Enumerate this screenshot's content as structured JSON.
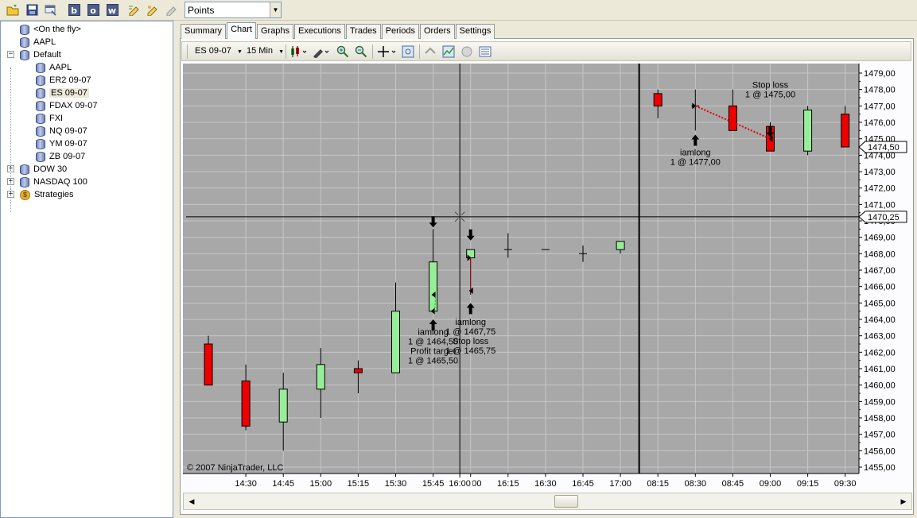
{
  "toolbar": {
    "buttons": [
      {
        "icon": "open-folder-icon"
      },
      {
        "icon": "save-icon"
      },
      {
        "icon": "window-icon"
      },
      {
        "label": "b"
      },
      {
        "label": "o"
      },
      {
        "label": "w"
      },
      {
        "icon": "pencil-icon"
      },
      {
        "icon": "edit-icon"
      },
      {
        "icon": "delete-icon"
      }
    ],
    "combo_value": "Points"
  },
  "tree": {
    "items": [
      {
        "label": "<On the fly>",
        "level": 1
      },
      {
        "label": "AAPL",
        "level": 1
      },
      {
        "label": "Default",
        "level": 0,
        "toggle": "−"
      },
      {
        "label": "AAPL",
        "level": 2
      },
      {
        "label": "ER2 09-07",
        "level": 2
      },
      {
        "label": "ES 09-07",
        "level": 2,
        "selected": true
      },
      {
        "label": "FDAX 09-07",
        "level": 2
      },
      {
        "label": "FXI",
        "level": 2
      },
      {
        "label": "NQ 09-07",
        "level": 2
      },
      {
        "label": "YM 09-07",
        "level": 2
      },
      {
        "label": "ZB 09-07",
        "level": 2
      },
      {
        "label": "DOW 30",
        "level": 0,
        "toggle": "+"
      },
      {
        "label": "NASDAQ 100",
        "level": 0,
        "toggle": "+"
      },
      {
        "label": "Strategies",
        "level": 0,
        "toggle": "+",
        "icon": "money"
      }
    ]
  },
  "tabs": [
    {
      "label": "Summary"
    },
    {
      "label": "Chart",
      "active": true
    },
    {
      "label": "Graphs"
    },
    {
      "label": "Executions"
    },
    {
      "label": "Trades"
    },
    {
      "label": "Periods"
    },
    {
      "label": "Orders"
    },
    {
      "label": "Settings"
    }
  ],
  "chart_toolbar": {
    "instrument": "ES 09-07",
    "interval": "15 Min"
  },
  "chart_data": {
    "type": "candlestick",
    "copyright": "© 2007 NinjaTrader, LLC",
    "ylim": [
      1454.5,
      1479.75
    ],
    "y_ticks": [
      "1455,00",
      "1456,00",
      "1457,00",
      "1458,00",
      "1459,00",
      "1460,00",
      "1461,00",
      "1462,00",
      "1463,00",
      "1464,00",
      "1465,00",
      "1466,00",
      "1467,00",
      "1468,00",
      "1469,00",
      "1470,00",
      "1471,00",
      "1472,00",
      "1473,00",
      "1474,00",
      "1475,00",
      "1476,00",
      "1477,00",
      "1478,00",
      "1479,00"
    ],
    "x_labels": [
      "14:30",
      "14:45",
      "15:00",
      "15:15",
      "15:30",
      "15:45",
      "16:00",
      "16:15",
      "16:30",
      "16:45",
      "17:00",
      "08:15",
      "08:30",
      "08:45",
      "09:00",
      "09:15",
      "09:30"
    ],
    "bars": [
      {
        "time": "14:15",
        "open": 1462.5,
        "high": 1463.0,
        "low": 1460.0,
        "close": 1460.0
      },
      {
        "time": "14:30",
        "open": 1460.25,
        "high": 1461.25,
        "low": 1457.25,
        "close": 1457.5
      },
      {
        "time": "14:45",
        "open": 1457.75,
        "high": 1460.75,
        "low": 1456.0,
        "close": 1459.75
      },
      {
        "time": "15:00",
        "open": 1459.75,
        "high": 1462.25,
        "low": 1458.0,
        "close": 1461.25
      },
      {
        "time": "15:15",
        "open": 1461.0,
        "high": 1461.5,
        "low": 1459.5,
        "close": 1460.75
      },
      {
        "time": "15:30",
        "open": 1460.75,
        "high": 1466.25,
        "low": 1460.75,
        "close": 1464.5
      },
      {
        "time": "15:45",
        "open": 1464.5,
        "high": 1469.5,
        "low": 1464.5,
        "close": 1467.5
      },
      {
        "time": "16:00",
        "open": 1467.75,
        "high": 1468.25,
        "low": 1465.5,
        "close": 1468.25
      },
      {
        "time": "16:15",
        "open": 1468.25,
        "high": 1469.25,
        "low": 1467.75,
        "close": 1468.25
      },
      {
        "time": "16:30",
        "open": 1468.25,
        "high": 1468.25,
        "low": 1468.25,
        "close": 1468.25
      },
      {
        "time": "16:45",
        "open": 1468.0,
        "high": 1468.5,
        "low": 1467.5,
        "close": 1468.0
      },
      {
        "time": "17:00",
        "open": 1468.25,
        "high": 1468.75,
        "low": 1468.0,
        "close": 1468.75
      },
      {
        "time": "08:15",
        "open": 1477.75,
        "high": 1478.0,
        "low": 1476.25,
        "close": 1477.0
      },
      {
        "time": "08:30",
        "open": 1477.0,
        "high": 1478.0,
        "low": 1475.5,
        "close": 1477.0
      },
      {
        "time": "08:45",
        "open": 1477.0,
        "high": 1478.0,
        "low": 1475.5,
        "close": 1475.5
      },
      {
        "time": "09:00",
        "open": 1475.75,
        "high": 1476.0,
        "low": 1474.25,
        "close": 1474.25
      },
      {
        "time": "09:15",
        "open": 1474.25,
        "high": 1477.0,
        "low": 1474.0,
        "close": 1476.75
      },
      {
        "time": "09:30",
        "open": 1476.5,
        "high": 1477.0,
        "low": 1474.5,
        "close": 1474.5
      }
    ],
    "annotations": [
      {
        "lines": [
          "iamlong",
          "1 @ 1464,50",
          "Profit target",
          "1 @ 1465,50"
        ]
      },
      {
        "lines": [
          "iamlong",
          "1 @ 1467,75",
          "Stop loss",
          "1 @ 1465,75"
        ]
      },
      {
        "lines": [
          "iamlong",
          "1 @ 1477,00"
        ]
      },
      {
        "lines": [
          "Stop loss",
          "1 @ 1475,00"
        ]
      }
    ],
    "last_price_label": "1474,50",
    "crosshair_price_label": "1470,25",
    "crosshair_time_label": "16:00",
    "crosshair_price": 1470.25,
    "crosshair_time_index": 7,
    "session_break_after_index": 11,
    "colors": {
      "bg": "#a8a8a8",
      "grid": "#c6c6c6",
      "up": "#98ee98",
      "down": "#ee0000",
      "trade_line": "#e00000"
    }
  },
  "scrollbar": {
    "left_icon": "scroll-left-icon",
    "right_icon": "scroll-right-icon"
  }
}
